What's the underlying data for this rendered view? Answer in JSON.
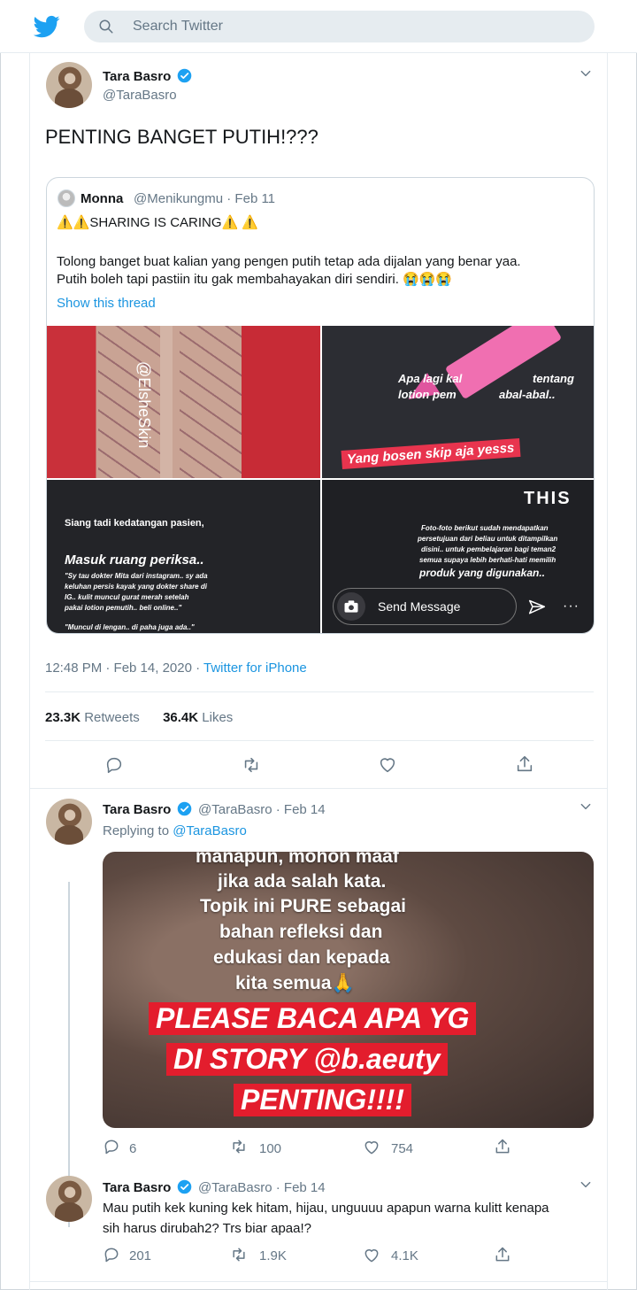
{
  "colors": {
    "accent": "#1da1f2",
    "link": "#1b95e0",
    "muted": "#657786",
    "border": "#e6ecf0"
  },
  "search": {
    "placeholder": "Search Twitter"
  },
  "main_tweet": {
    "name": "Tara Basro",
    "handle": "@TaraBasro",
    "text": "PENTING BANGET PUTIH!???",
    "timestamp": "12:48 PM · Feb 14, 2020 · ",
    "source": "Twitter for iPhone",
    "retweets": "23.3K",
    "retweets_label": "Retweets",
    "likes": "36.4K",
    "likes_label": "Likes"
  },
  "quoted_tweet": {
    "name": "Monna",
    "handle_date": "@Menikungmu · Feb 11",
    "line1": "⚠️⚠️SHARING IS CARING⚠️ ⚠️",
    "line2": "Tolong banget buat kalian yang pengen putih tetap ada dijalan yang benar yaa.",
    "line3": "Putih boleh tapi pastiin itu gak membahayakan diri sendiri. 😭😭😭",
    "show_thread": "Show this thread",
    "images": {
      "img1_watermark": "@ElsheSkin",
      "img2_line1": "Apa lagi kal",
      "img2_line1b": "tentang",
      "img2_line2": "lotion pem",
      "img2_line2b": "abal-abal..",
      "img2_red": "Yang bosen skip aja yesss",
      "img3_line1": "Siang tadi kedatangan pasien,",
      "img3_line2": "Masuk ruang periksa..",
      "img3_line3": "\"Sy tau dokter Mita dari instagram.. sy ada",
      "img3_line4": "keluhan persis kayak yang dokter share di",
      "img3_line5": "IG.. kulit muncul gurat merah setelah",
      "img3_line6": "pakai lotion pemutih.. beli online..\"",
      "img3_line7": "\"Muncul di lengan.. di paha juga ada..\"",
      "img4_badge": "THIS",
      "img4_line1": "Foto-foto berikut sudah mendapatkan",
      "img4_line2": "persetujuan dari beliau untuk ditampilkan",
      "img4_line3": "disini.. untuk pembelajaran bagi teman2",
      "img4_line4": "semua supaya lebih berhati-hati memilih",
      "img4_line5": "produk yang digunakan..",
      "send_message": "Send Message",
      "more": "···"
    }
  },
  "reply1": {
    "name": "Tara Basro",
    "handle_date": "@TaraBasro · Feb 14",
    "replying_prefix": "Replying to ",
    "replying_to": "@TaraBasro",
    "image_lines": [
      "manapun, mohon maaf",
      "jika ada salah kata.",
      "Topik ini PURE sebagai",
      "bahan refleksi dan",
      "edukasi dan kepada",
      "kita semua🙏"
    ],
    "image_red": [
      "PLEASE BACA APA YG",
      "DI STORY @b.aeuty",
      "PENTING!!!!"
    ],
    "replies": "6",
    "retweets": "100",
    "likes": "754"
  },
  "reply2": {
    "name": "Tara Basro",
    "handle_date": "@TaraBasro · Feb 14",
    "line1": "Mau putih kek kuning kek hitam, hijau, unguuuu apapun warna kulitt kenapa",
    "line2": "sih harus dirubah2? Trs biar apaa!?",
    "replies": "201",
    "retweets": "1.9K",
    "likes": "4.1K"
  }
}
